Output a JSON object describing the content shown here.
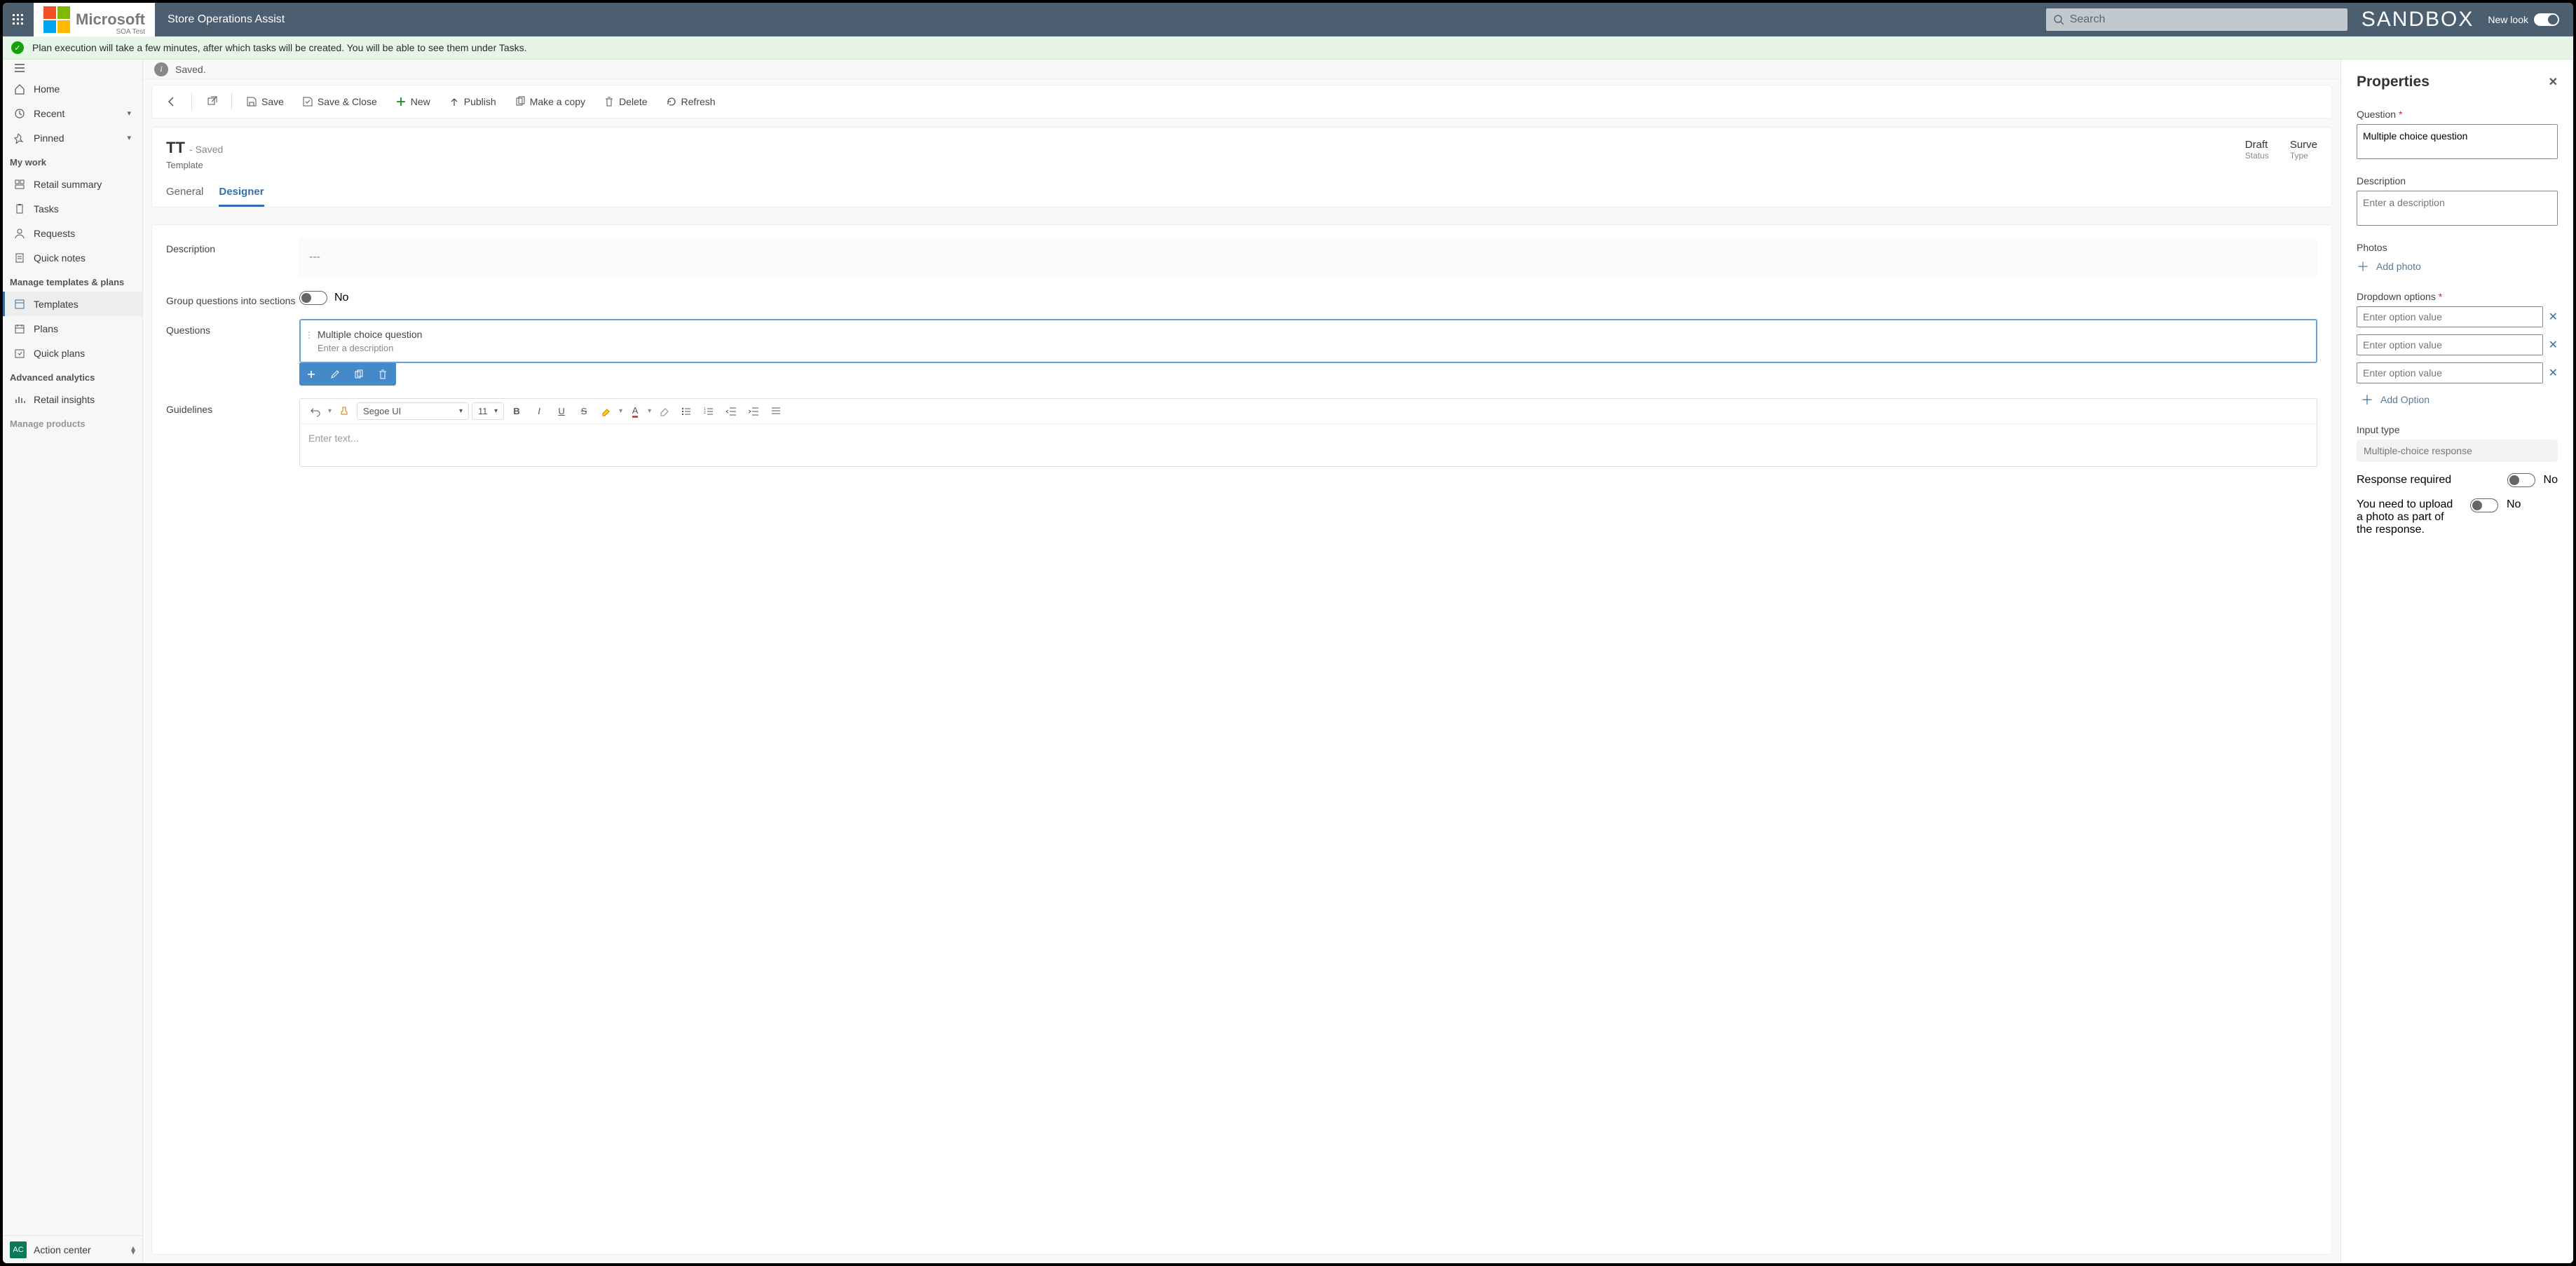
{
  "header": {
    "brand": "Microsoft",
    "brand_sub": "SOA Test",
    "app_name": "Store Operations Assist",
    "search_placeholder": "Search",
    "sandbox": "SANDBOX",
    "new_look": "New look"
  },
  "notice": {
    "text": "Plan execution will take a few minutes, after which tasks will be created. You will be able to see them under Tasks."
  },
  "sidebar": {
    "home": "Home",
    "recent": "Recent",
    "pinned": "Pinned",
    "groups": {
      "mywork": "My work",
      "manage_tpl": "Manage templates & plans",
      "advanced": "Advanced analytics",
      "manage_products": "Manage products"
    },
    "items": {
      "retail_summary": "Retail summary",
      "tasks": "Tasks",
      "requests": "Requests",
      "quick_notes": "Quick notes",
      "templates": "Templates",
      "plans": "Plans",
      "quick_plans": "Quick plans",
      "retail_insights": "Retail insights"
    },
    "action_center_badge": "AC",
    "action_center": "Action center"
  },
  "saved_strip": {
    "text": "Saved."
  },
  "commands": {
    "save": "Save",
    "save_close": "Save & Close",
    "new": "New",
    "publish": "Publish",
    "make_copy": "Make a copy",
    "delete": "Delete",
    "refresh": "Refresh"
  },
  "record": {
    "title": "TT",
    "saved_suffix": "- Saved",
    "subtitle": "Template",
    "meta": {
      "status_value": "Draft",
      "status_label": "Status",
      "type_value": "Surve",
      "type_label": "Type"
    },
    "tabs": {
      "general": "General",
      "designer": "Designer"
    }
  },
  "form": {
    "description_label": "Description",
    "description_value": "---",
    "group_label": "Group questions into sections",
    "group_value": "No",
    "questions_label": "Questions",
    "guidelines_label": "Guidelines",
    "question_card": {
      "title": "Multiple choice question",
      "desc": "Enter a description"
    },
    "rte": {
      "font": "Segoe UI",
      "size": "11",
      "placeholder": "Enter text..."
    }
  },
  "properties": {
    "title": "Properties",
    "question_label": "Question",
    "question_value": "Multiple choice question",
    "description_label": "Description",
    "description_placeholder": "Enter a description",
    "photos_label": "Photos",
    "add_photo": "Add photo",
    "dropdown_label": "Dropdown options",
    "option_placeholder": "Enter option value",
    "add_option": "Add Option",
    "input_type_label": "Input type",
    "input_type_value": "Multiple-choice response",
    "response_required_label": "Response required",
    "response_required_value": "No",
    "upload_photo_label": "You need to upload a photo as part of the response.",
    "upload_photo_value": "No"
  }
}
